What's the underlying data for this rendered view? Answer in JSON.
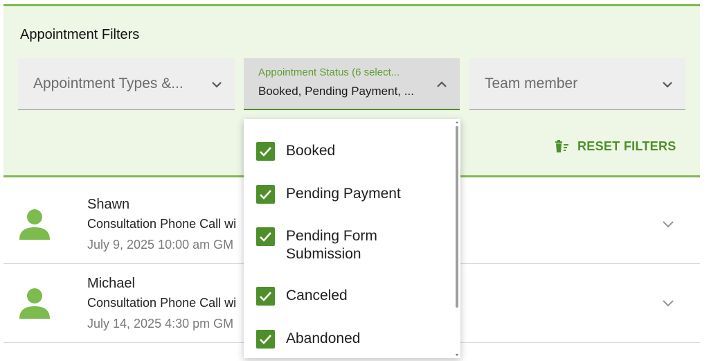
{
  "filters": {
    "title": "Appointment Filters",
    "appointment_types": {
      "placeholder": "Appointment Types &..."
    },
    "appointment_status": {
      "label": "Appointment Status (6 select...",
      "value": "Booked, Pending Payment, ..."
    },
    "team_member": {
      "placeholder": "Team member"
    },
    "reset_label": "RESET FILTERS"
  },
  "status_options": [
    {
      "label": "Booked",
      "checked": true
    },
    {
      "label": "Pending Payment",
      "checked": true
    },
    {
      "label": "Pending Form Submission",
      "checked": true
    },
    {
      "label": "Canceled",
      "checked": true
    },
    {
      "label": "Abandoned",
      "checked": true
    }
  ],
  "appointments": [
    {
      "name": "Shawn",
      "service": "Consultation Phone Call wi",
      "time": "July 9, 2025 10:00 am GM"
    },
    {
      "name": "Michael",
      "service": "Consultation Phone Call wi",
      "time": "July 14, 2025 4:30 pm GM"
    }
  ],
  "colors": {
    "accent": "#4f8f2b",
    "panel_bg": "#eef6e6",
    "avatar": "#7cbb4d",
    "border": "#7cbb4d"
  },
  "icons": [
    "chevron-down-icon",
    "chevron-up-icon",
    "trash-filter-icon",
    "person-icon",
    "checkmark-icon"
  ]
}
